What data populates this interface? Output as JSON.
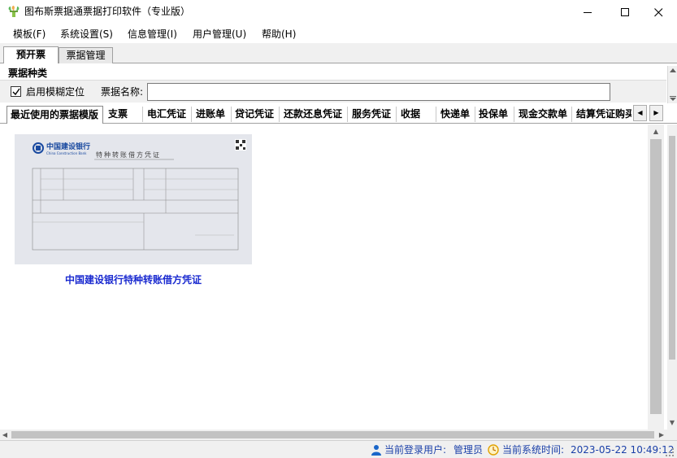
{
  "window": {
    "title": "图布斯票据通票据打印软件（专业版）"
  },
  "menu": [
    {
      "label": "模板(F)"
    },
    {
      "label": "系统设置(S)"
    },
    {
      "label": "信息管理(I)"
    },
    {
      "label": "用户管理(U)"
    },
    {
      "label": "帮助(H)"
    }
  ],
  "outer_tabs": [
    {
      "label": "预开票",
      "active": true
    },
    {
      "label": "票据管理",
      "active": false
    }
  ],
  "ticket_types": {
    "group_label": "票据种类",
    "fuzzy_locate_label": "启用模糊定位",
    "fuzzy_locate_checked": true,
    "name_label": "票据名称:",
    "name_value": ""
  },
  "inner_tabs": [
    {
      "label": "最近使用的票据模版",
      "active": true
    },
    {
      "label": "支票"
    },
    {
      "label": "电汇凭证"
    },
    {
      "label": "进账单"
    },
    {
      "label": "贷记凭证"
    },
    {
      "label": "还款还息凭证"
    },
    {
      "label": "服务凭证"
    },
    {
      "label": "收据"
    },
    {
      "label": "快递单"
    },
    {
      "label": "投保单"
    },
    {
      "label": "现金交款单"
    },
    {
      "label": "结算凭证购买"
    }
  ],
  "templates": [
    {
      "name": "中国建设银行特种转账借方凭证",
      "preview": {
        "bank_name": "中国建设银行",
        "bank_name_en": "China Construction Bank",
        "form_title": "特种转账借方凭证"
      }
    }
  ],
  "status": {
    "user_label": "当前登录用户:",
    "user_value": "管理员",
    "time_label": "当前系统时间:",
    "time_value": "2023-05-22 10:49:12"
  },
  "colors": {
    "accent_blue": "#1b2bd0",
    "status_text": "#1a3fa8",
    "bank_blue": "#1a4aa0"
  }
}
